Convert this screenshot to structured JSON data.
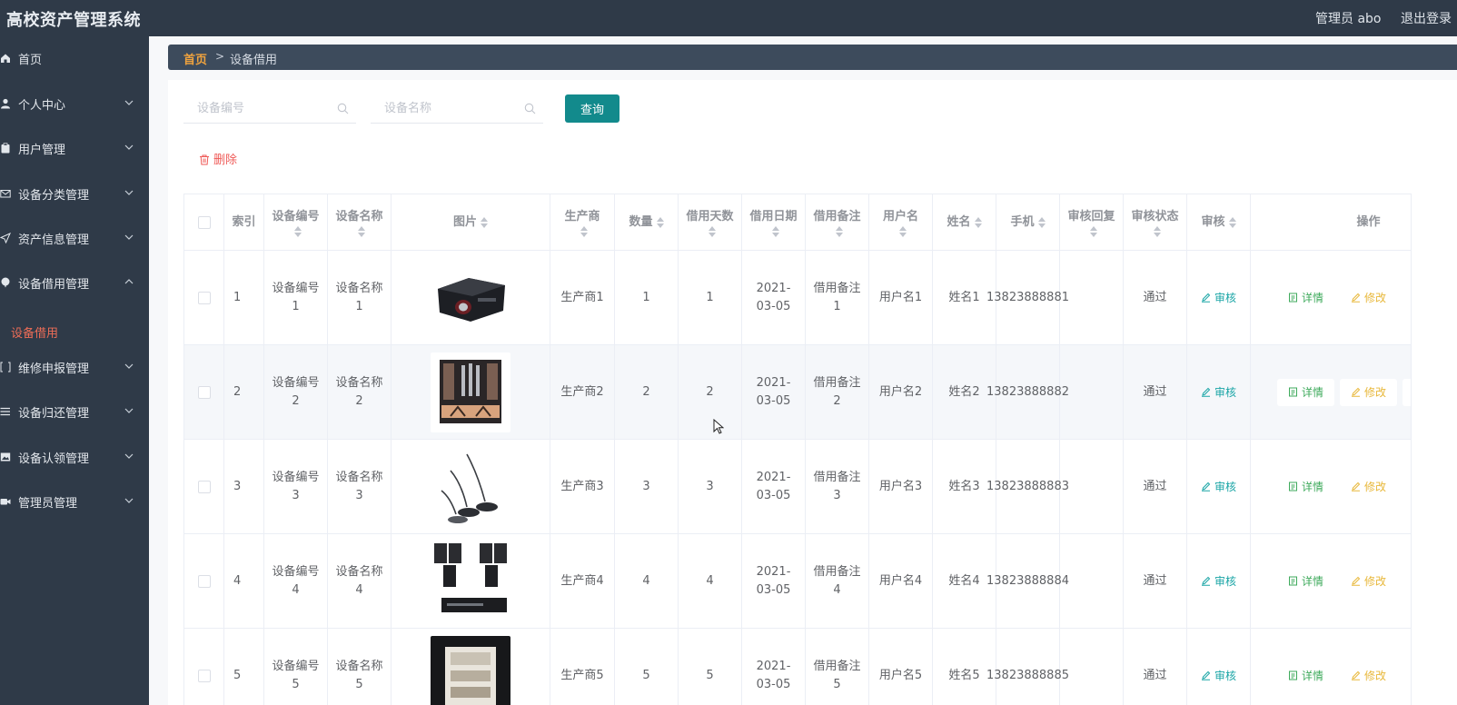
{
  "app": {
    "title": "高校资产管理系统",
    "user": "管理员 abo",
    "logout": "退出登录"
  },
  "sidebar": {
    "items": [
      {
        "label": "首页",
        "icon": "home-icon",
        "chevron": ""
      },
      {
        "label": "个人中心",
        "icon": "user-icon",
        "chevron": "down"
      },
      {
        "label": "用户管理",
        "icon": "clipboard-icon",
        "chevron": "down"
      },
      {
        "label": "设备分类管理",
        "icon": "mail-icon",
        "chevron": "down"
      },
      {
        "label": "资产信息管理",
        "icon": "send-icon",
        "chevron": "down"
      },
      {
        "label": "设备借用管理",
        "icon": "balloon-icon",
        "chevron": "up"
      },
      {
        "label": "维修申报管理",
        "icon": "bracket-icon",
        "chevron": "down"
      },
      {
        "label": "设备归还管理",
        "icon": "list-icon",
        "chevron": "down"
      },
      {
        "label": "设备认领管理",
        "icon": "image-icon",
        "chevron": "down"
      },
      {
        "label": "管理员管理",
        "icon": "video-icon",
        "chevron": "down"
      }
    ],
    "active_sub": "设备借用",
    "colors": {
      "bg": "#2f3a48",
      "active": "#ef6d57"
    }
  },
  "breadcrumb": {
    "home": "首页",
    "separator": ">",
    "current": "设备借用"
  },
  "search": {
    "code_placeholder": "设备编号",
    "name_placeholder": "设备名称",
    "query_label": "查询"
  },
  "toolbar": {
    "delete_label": "删除"
  },
  "table": {
    "headers": {
      "index": "索引",
      "code": "设备编号",
      "name": "设备名称",
      "image": "图片",
      "maker": "生产商",
      "qty": "数量",
      "days": "借用天数",
      "date": "借用日期",
      "note": "借用备注",
      "username": "用户名",
      "realname": "姓名",
      "phone": "手机",
      "reply": "审核回复",
      "status": "审核状态",
      "audit": "审核",
      "ops": "操作"
    },
    "actions": {
      "audit": "审核",
      "detail": "详情",
      "edit": "修改"
    },
    "rows": [
      {
        "index": "1",
        "code": "设备编号1",
        "name": "设备名称1",
        "image": "projector",
        "maker": "生产商1",
        "qty": "1",
        "days": "1",
        "date": "2021-03-05",
        "note": "借用备注1",
        "username": "用户名1",
        "realname": "姓名1",
        "phone": "13823888881",
        "reply": "",
        "status": "通过"
      },
      {
        "index": "2",
        "code": "设备编号2",
        "name": "设备名称2",
        "image": "mic-amplifier",
        "maker": "生产商2",
        "qty": "2",
        "days": "2",
        "date": "2021-03-05",
        "note": "借用备注2",
        "username": "用户名2",
        "realname": "姓名2",
        "phone": "13823888882",
        "reply": "",
        "status": "通过"
      },
      {
        "index": "3",
        "code": "设备编号3",
        "name": "设备名称3",
        "image": "conference-mics",
        "maker": "生产商3",
        "qty": "3",
        "days": "3",
        "date": "2021-03-05",
        "note": "借用备注3",
        "username": "用户名3",
        "realname": "姓名3",
        "phone": "13823888883",
        "reply": "",
        "status": "通过"
      },
      {
        "index": "4",
        "code": "设备编号4",
        "name": "设备名称4",
        "image": "speakers",
        "maker": "生产商4",
        "qty": "4",
        "days": "4",
        "date": "2021-03-05",
        "note": "借用备注4",
        "username": "用户名4",
        "realname": "姓名4",
        "phone": "13823888884",
        "reply": "",
        "status": "通过"
      },
      {
        "index": "5",
        "code": "设备编号5",
        "name": "设备名称5",
        "image": "av-cabinet",
        "maker": "生产商5",
        "qty": "5",
        "days": "5",
        "date": "2021-03-05",
        "note": "借用备注5",
        "username": "用户名5",
        "realname": "姓名5",
        "phone": "13823888885",
        "reply": "",
        "status": "通过"
      }
    ]
  },
  "colors": {
    "query_button": "#128a8c",
    "delete": "#ef5a57",
    "audit": "#1aa5a6",
    "detail": "#3eaa5b",
    "edit": "#e8b83b",
    "crumb_home": "#f0a33e"
  }
}
